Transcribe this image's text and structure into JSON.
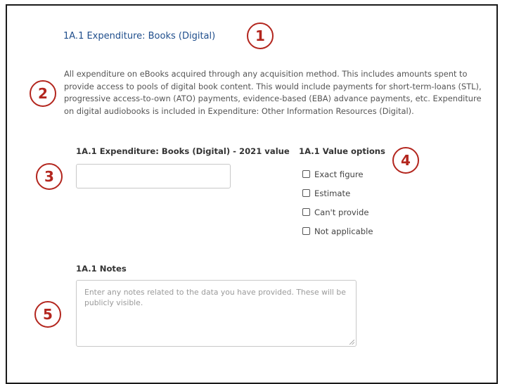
{
  "section": {
    "title": "1A.1 Expenditure: Books (Digital)",
    "description": "All expenditure on eBooks acquired through any acquisition method. This includes amounts spent to provide access to pools of digital book content. This would include payments for short-term-loans (STL), progressive access-to-own (ATO) payments, evidence-based (EBA) advance payments, etc. Expenditure on digital audiobooks is included in Expenditure: Other Information Resources (Digital)."
  },
  "value_field": {
    "label": "1A.1 Expenditure: Books (Digital) - 2021 value",
    "value": ""
  },
  "value_options": {
    "label": "1A.1 Value options",
    "options": [
      {
        "label": "Exact figure",
        "checked": false
      },
      {
        "label": "Estimate",
        "checked": false
      },
      {
        "label": "Can't provide",
        "checked": false
      },
      {
        "label": "Not applicable",
        "checked": false
      }
    ]
  },
  "notes": {
    "label": "1A.1 Notes",
    "placeholder": "Enter any notes related to the data you have provided. These will be publicly visible."
  },
  "callouts": [
    "1",
    "2",
    "3",
    "4",
    "5"
  ],
  "colors": {
    "callout": "#b3261e",
    "title_link": "#1f4e8c"
  }
}
